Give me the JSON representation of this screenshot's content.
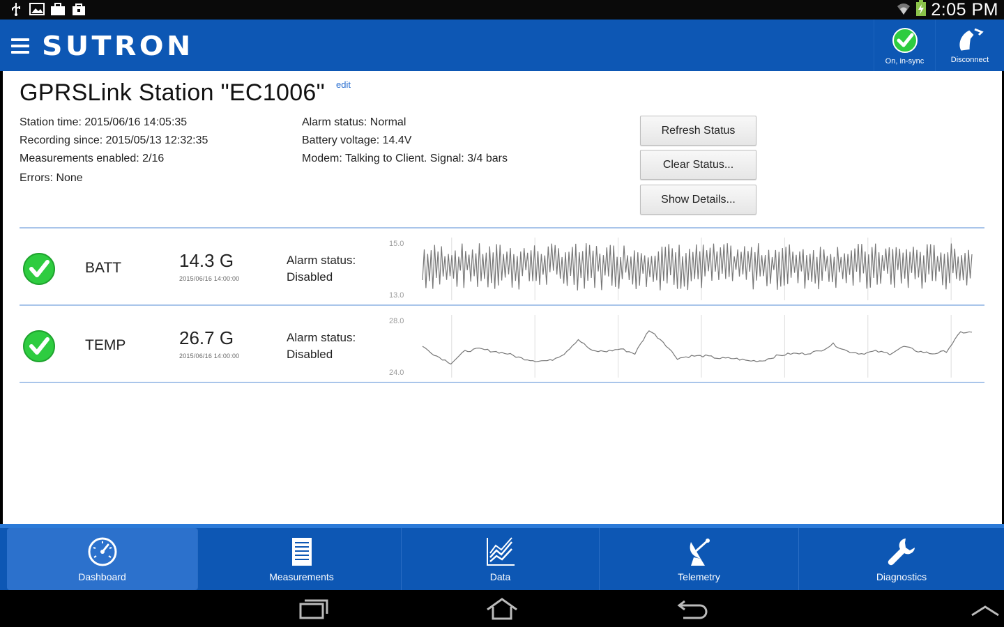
{
  "status_bar": {
    "time": "2:05 PM",
    "icons": [
      "usb-icon",
      "image-icon",
      "briefcase-icon",
      "bag-icon",
      "wifi-icon",
      "battery-icon"
    ]
  },
  "app_bar": {
    "brand": "SUTRON",
    "actions": [
      {
        "label": "On, in-sync",
        "icon": "check-circle-icon"
      },
      {
        "label": "Disconnect",
        "icon": "phone-hangup-icon"
      }
    ]
  },
  "station": {
    "title": "GPRSLink Station \"EC1006\"",
    "edit_label": "edit",
    "station_time": "Station time: 2015/06/16 14:05:35",
    "recording_since": "Recording since: 2015/05/13 12:32:35",
    "measurements_enabled": "Measurements enabled: 2/16",
    "errors": "Errors: None",
    "alarm_status": "Alarm status: Normal",
    "battery_voltage": "Battery voltage: 14.4V",
    "modem": "Modem: Talking to Client. Signal: 3/4 bars"
  },
  "buttons": {
    "refresh": "Refresh Status",
    "clear": "Clear Status...",
    "details": "Show Details..."
  },
  "measurements": [
    {
      "name": "BATT",
      "value": "14.3 G",
      "timestamp": "2015/06/16 14:00:00",
      "alarm_label": "Alarm status:",
      "alarm_value": "Disabled",
      "chart_max": "15.0",
      "chart_min": "13.0",
      "status_icon": "check-circle-icon"
    },
    {
      "name": "TEMP",
      "value": "26.7 G",
      "timestamp": "2015/06/16 14:00:00",
      "alarm_label": "Alarm status:",
      "alarm_value": "Disabled",
      "chart_max": "28.0",
      "chart_min": "24.0",
      "status_icon": "check-circle-icon"
    }
  ],
  "tabs": [
    {
      "label": "Dashboard",
      "icon": "dashboard-gauge-icon",
      "active": true
    },
    {
      "label": "Measurements",
      "icon": "list-document-icon",
      "active": false
    },
    {
      "label": "Data",
      "icon": "line-chart-icon",
      "active": false
    },
    {
      "label": "Telemetry",
      "icon": "satellite-dish-icon",
      "active": false
    },
    {
      "label": "Diagnostics",
      "icon": "wrench-icon",
      "active": false
    }
  ],
  "nav_bar": {
    "buttons": [
      "recent-apps-icon",
      "home-icon",
      "back-icon",
      "collapse-icon"
    ]
  },
  "colors": {
    "primary": "#0d57b4",
    "accent": "#2a6fd0",
    "ok_green": "#2ecc40",
    "separator": "#a9c5ea"
  }
}
